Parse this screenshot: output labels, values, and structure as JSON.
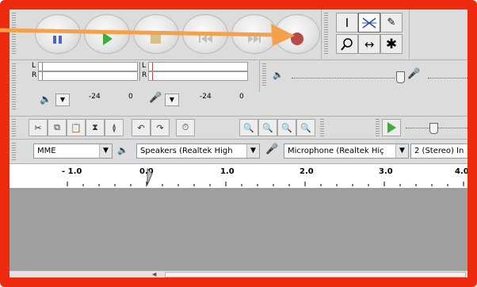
{
  "meters": {
    "record_left": "L",
    "record_right": "R",
    "play_left": "L",
    "play_right": "R",
    "ticks_play": [
      "-24",
      "0"
    ],
    "ticks_record": [
      "-24",
      "0"
    ]
  },
  "devices": {
    "host": "MME",
    "output": "Speakers (Realtek High",
    "input": "Microphone (Realtek Hiç",
    "channels": "2 (Stereo) In"
  },
  "ruler": {
    "ticks": [
      "- 1.0",
      "0.0",
      "1.0",
      "2.0",
      "3.0",
      "4.0"
    ]
  },
  "colors": {
    "frame": "#ee2a0e",
    "arrow": "#f5a04a",
    "record_button": "#b84a4a",
    "play_button": "#3cae3c",
    "pause_button": "#4a64c8",
    "track_area": "#9f9f9f"
  },
  "icons": {
    "transport": [
      "pause-icon",
      "play-icon",
      "stop-icon",
      "skip-start-icon",
      "skip-end-icon",
      "record-icon"
    ],
    "tools": [
      "selection-tool-icon",
      "envelope-tool-icon",
      "draw-tool-icon",
      "zoom-tool-icon",
      "timeshift-tool-icon",
      "multi-tool-icon"
    ]
  }
}
